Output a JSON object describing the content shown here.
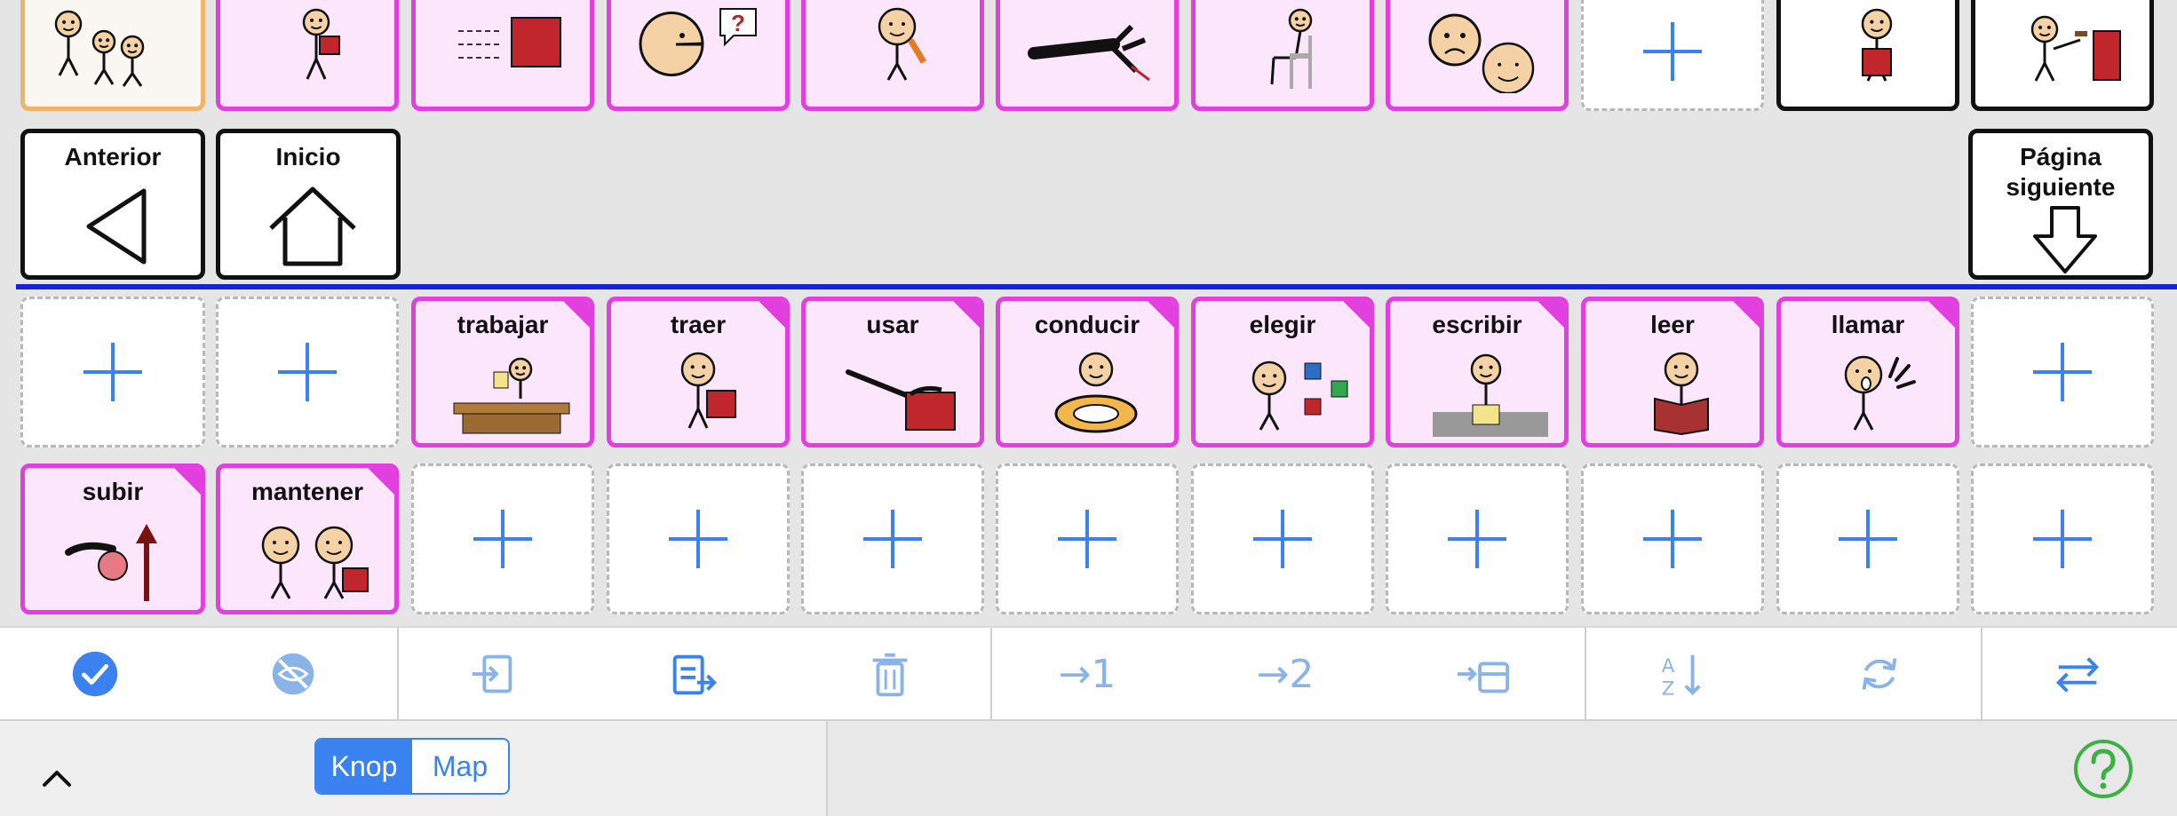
{
  "board": {
    "top_row": [
      {
        "label": "",
        "icon": "people-group-icon",
        "style": "sel"
      },
      {
        "label": "",
        "icon": "walking-person-with-box-icon",
        "style": "pink"
      },
      {
        "label": "",
        "icon": "moving-red-square-icon",
        "style": "pink"
      },
      {
        "label": "",
        "icon": "face-question-icon",
        "style": "pink"
      },
      {
        "label": "",
        "icon": "person-eating-carrot-icon",
        "style": "pink"
      },
      {
        "label": "",
        "icon": "hand-pulling-icon",
        "style": "pink"
      },
      {
        "label": "",
        "icon": "person-sitting-chair-icon",
        "style": "pink"
      },
      {
        "label": "",
        "icon": "sad-happy-faces-icon",
        "style": "pink"
      },
      {
        "label": "",
        "icon": "plus-icon",
        "style": "empty"
      },
      {
        "label": "",
        "icon": "person-holding-box-icon",
        "style": "white"
      },
      {
        "label": "",
        "icon": "person-hammering-icon",
        "style": "white"
      }
    ],
    "nav": {
      "prev_label": "Anterior",
      "home_label": "Inicio",
      "next_label": "Página\nsiguiente"
    },
    "row1": [
      {
        "label": "",
        "icon": "plus-icon",
        "style": "empty"
      },
      {
        "label": "",
        "icon": "plus-icon",
        "style": "empty"
      },
      {
        "label": "trabajar",
        "icon": "person-at-desk-icon",
        "style": "pink"
      },
      {
        "label": "traer",
        "icon": "person-bringing-box-icon",
        "style": "pink"
      },
      {
        "label": "usar",
        "icon": "hand-using-tool-icon",
        "style": "pink"
      },
      {
        "label": "conducir",
        "icon": "person-driving-wheel-icon",
        "style": "pink"
      },
      {
        "label": "elegir",
        "icon": "person-choosing-squares-icon",
        "style": "pink"
      },
      {
        "label": "escribir",
        "icon": "person-writing-icon",
        "style": "pink"
      },
      {
        "label": "leer",
        "icon": "person-reading-book-icon",
        "style": "pink"
      },
      {
        "label": "llamar",
        "icon": "person-calling-icon",
        "style": "pink"
      },
      {
        "label": "",
        "icon": "plus-icon",
        "style": "empty"
      }
    ],
    "row2": [
      {
        "label": "subir",
        "icon": "hand-arrow-up-icon",
        "style": "pink"
      },
      {
        "label": "mantener",
        "icon": "two-people-box-icon",
        "style": "pink"
      },
      {
        "label": "",
        "icon": "plus-icon",
        "style": "empty"
      },
      {
        "label": "",
        "icon": "plus-icon",
        "style": "empty"
      },
      {
        "label": "",
        "icon": "plus-icon",
        "style": "empty"
      },
      {
        "label": "",
        "icon": "plus-icon",
        "style": "empty"
      },
      {
        "label": "",
        "icon": "plus-icon",
        "style": "empty"
      },
      {
        "label": "",
        "icon": "plus-icon",
        "style": "empty"
      },
      {
        "label": "",
        "icon": "plus-icon",
        "style": "empty"
      },
      {
        "label": "",
        "icon": "plus-icon",
        "style": "empty"
      },
      {
        "label": "",
        "icon": "plus-icon",
        "style": "empty"
      }
    ]
  },
  "toolbar": {
    "buttons": [
      {
        "icon": "check-circle-icon"
      },
      {
        "icon": "hide-eye-icon"
      },
      {
        "icon": "move-in-icon"
      },
      {
        "icon": "paste-icon"
      },
      {
        "icon": "trash-icon"
      },
      {
        "icon": "move-to-1-icon",
        "text": "→1"
      },
      {
        "icon": "move-to-2-icon",
        "text": "→2"
      },
      {
        "icon": "move-to-archive-icon"
      },
      {
        "icon": "sort-az-icon"
      },
      {
        "icon": "refresh-icon"
      },
      {
        "icon": "swap-icon"
      }
    ]
  },
  "bottom": {
    "segment_on": "Knop",
    "segment_off": "Map"
  },
  "colors": {
    "accent": "#3a82f0",
    "tile_border_pink": "#e23fdf",
    "tile_bg_pink": "#fbe6fb",
    "divider": "#1a22d6",
    "help": "#3cb043"
  }
}
